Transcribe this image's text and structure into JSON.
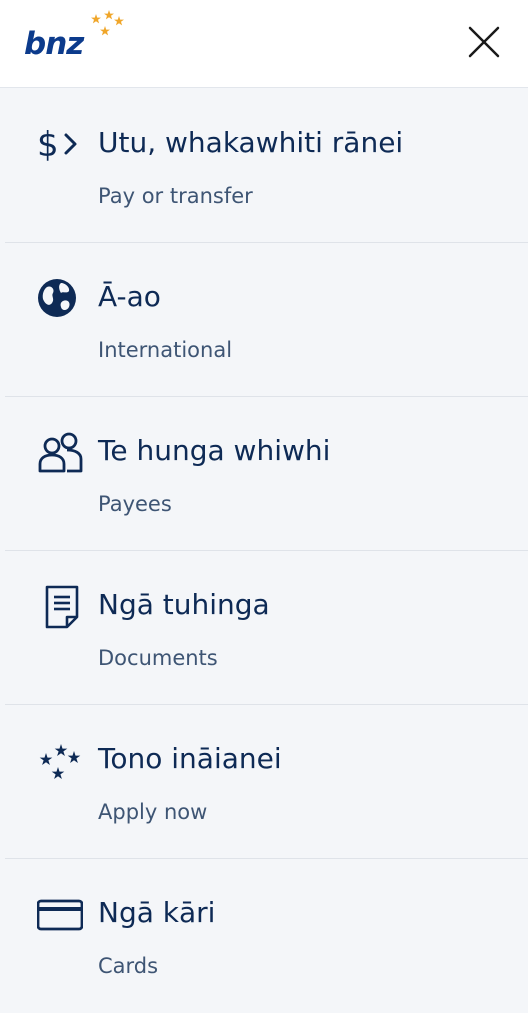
{
  "header": {
    "logo_text": "bnz",
    "logo_icon": "bnz-stars-logo",
    "close_icon": "close-icon"
  },
  "colors": {
    "brand_navy": "#0c3b8c",
    "text_navy": "#0e2a55",
    "subtext": "#3e5574",
    "star_gold": "#f0a62a",
    "background": "#f4f6f9"
  },
  "menu": {
    "items": [
      {
        "icon": "pay-transfer-icon",
        "title": "Utu, whakawhiti rānei",
        "subtitle": "Pay or transfer"
      },
      {
        "icon": "globe-icon",
        "title": "Ā-ao",
        "subtitle": "International"
      },
      {
        "icon": "payees-icon",
        "title": "Te hunga whiwhi",
        "subtitle": "Payees"
      },
      {
        "icon": "document-icon",
        "title": "Ngā tuhinga",
        "subtitle": "Documents"
      },
      {
        "icon": "stars-icon",
        "title": "Tono ināianei",
        "subtitle": "Apply now"
      },
      {
        "icon": "card-icon",
        "title": "Ngā kāri",
        "subtitle": "Cards"
      }
    ]
  }
}
